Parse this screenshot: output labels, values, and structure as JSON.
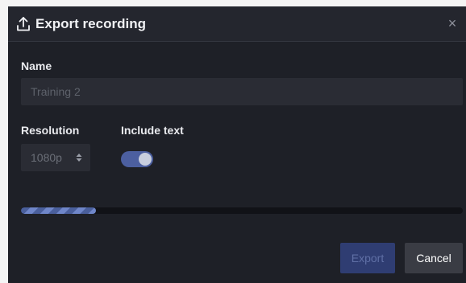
{
  "dialog": {
    "title": "Export recording",
    "close_glyph": "×",
    "icons": {
      "title": "upload-icon",
      "close": "close-icon",
      "select": "sort-caret-icon"
    }
  },
  "name_field": {
    "label": "Name",
    "value": "",
    "placeholder": "Training 2"
  },
  "resolution": {
    "label": "Resolution",
    "selected": "1080p"
  },
  "include_text": {
    "label": "Include text",
    "enabled": true
  },
  "progress": {
    "fraction": 0.17
  },
  "buttons": {
    "export": "Export",
    "cancel": "Cancel"
  },
  "colors": {
    "dialog_bg": "#1e2027",
    "accent": "#4c5fa0",
    "progress": "#6f86c9"
  }
}
